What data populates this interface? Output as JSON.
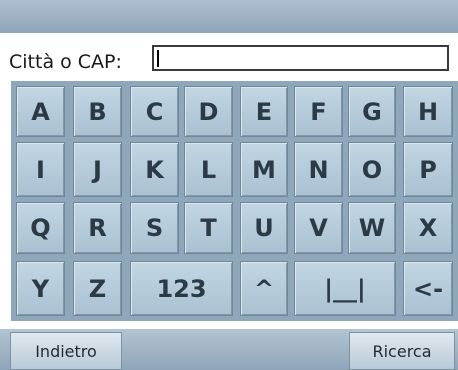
{
  "search": {
    "label": "Città o CAP:",
    "value": "",
    "placeholder": ""
  },
  "keyboard": {
    "rows": [
      [
        "A",
        "B",
        "C",
        "D",
        "E",
        "F",
        "G",
        "H"
      ],
      [
        "I",
        "J",
        "K",
        "L",
        "M",
        "N",
        "O",
        "P"
      ],
      [
        "Q",
        "R",
        "S",
        "T",
        "U",
        "V",
        "W",
        "X"
      ]
    ],
    "last_row": {
      "y": "Y",
      "z": "Z",
      "numbers": "123",
      "caret": "^",
      "space": "|__|",
      "backspace": "<-"
    }
  },
  "footer": {
    "back_label": "Indietro",
    "search_label": "Ricerca"
  }
}
